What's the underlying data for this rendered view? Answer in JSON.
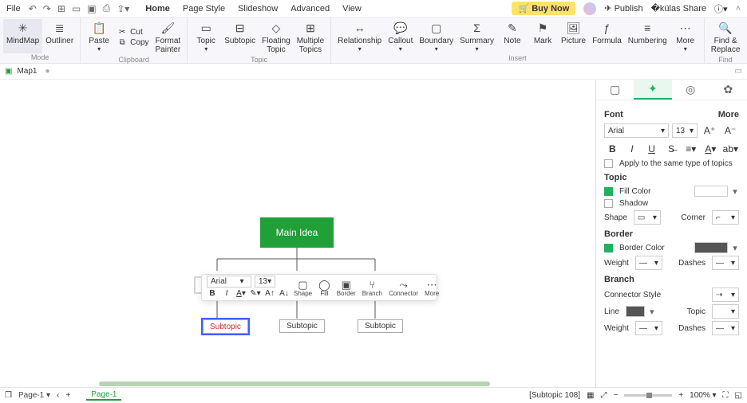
{
  "menu": {
    "file": "File",
    "tabs": [
      "Home",
      "Page Style",
      "Slideshow",
      "Advanced",
      "View"
    ],
    "active_tab": 0,
    "buynow": "Buy Now",
    "publish": "Publish",
    "share": "Share"
  },
  "ribbon": {
    "mode": {
      "label": "Mode",
      "mindmap": "MindMap",
      "outliner": "Outliner"
    },
    "clipboard": {
      "label": "Clipboard",
      "paste": "Paste",
      "cut": "Cut",
      "copy": "Copy",
      "fp": "Format\nPainter"
    },
    "topic": {
      "label": "Topic",
      "topic": "Topic",
      "subtopic": "Subtopic",
      "floating": "Floating\nTopic",
      "multiple": "Multiple\nTopics"
    },
    "insert": {
      "label": "Insert",
      "relationship": "Relationship",
      "callout": "Callout",
      "boundary": "Boundary",
      "summary": "Summary",
      "note": "Note",
      "mark": "Mark",
      "picture": "Picture",
      "formula": "Formula",
      "numbering": "Numbering",
      "more": "More"
    },
    "find": {
      "label": "Find",
      "findrep": "Find &\nReplace"
    }
  },
  "maptab": {
    "name": "Map1"
  },
  "canvas": {
    "main": "Main Idea",
    "sub1": "Subtopic",
    "sub2": "Subtopic",
    "sub3": "Subtopic"
  },
  "ctx": {
    "font": "Arial",
    "size": "13",
    "shape": "Shape",
    "fill": "Fill",
    "border": "Border",
    "branch": "Branch",
    "connector": "Connector",
    "more": "More"
  },
  "panel": {
    "font": {
      "hdr": "Font",
      "more": "More",
      "name": "Arial",
      "size": "13",
      "apply": "Apply to the same type of topics"
    },
    "topic": {
      "hdr": "Topic",
      "fill": "Fill Color",
      "shadow": "Shadow",
      "shape": "Shape",
      "corner": "Corner"
    },
    "border": {
      "hdr": "Border",
      "color": "Border Color",
      "weight": "Weight",
      "dashes": "Dashes"
    },
    "branch": {
      "hdr": "Branch",
      "cs": "Connector Style",
      "line": "Line",
      "topic": "Topic",
      "weight": "Weight",
      "dashes": "Dashes"
    }
  },
  "status": {
    "page": "Page-1",
    "pgtab": "Page-1",
    "sel": "[Subtopic 108]",
    "zoom": "100%"
  }
}
